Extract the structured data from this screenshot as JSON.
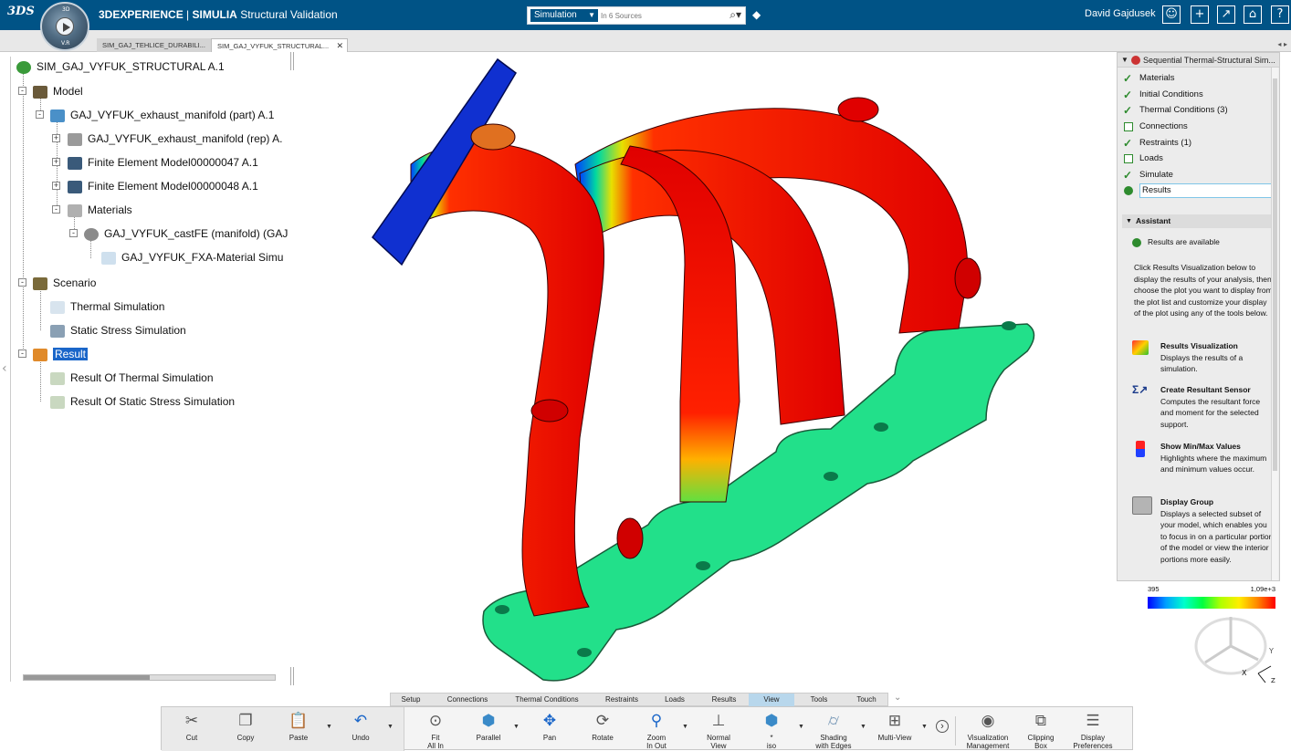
{
  "header": {
    "brand": "3DEXPERIENCE",
    "app_family": "SIMULIA",
    "app_name": "Structural Validation",
    "compass_north": "3D",
    "compass_south": "V.R",
    "search_scope": "Simulation",
    "search_placeholder": "In 6 Sources",
    "user_name": "David Gajdusek"
  },
  "tabs": [
    {
      "label": "SIM_GAJ_TEHLICE_DURABILI..."
    },
    {
      "label": "SIM_GAJ_VYFUK_STRUCTURAL..."
    }
  ],
  "tree": {
    "root": "SIM_GAJ_VYFUK_STRUCTURAL A.1",
    "model": "Model",
    "part": "GAJ_VYFUK_exhaust_manifold (part) A.1",
    "rep": "GAJ_VYFUK_exhaust_manifold (rep) A.",
    "fem47": "Finite Element Model00000047 A.1",
    "fem48": "Finite Element Model00000048 A.1",
    "materials": "Materials",
    "castfe": "GAJ_VYFUK_castFE (manifold) (GAJ",
    "fxa": "GAJ_VYFUK_FXA-Material Simu",
    "scenario": "Scenario",
    "thermal": "Thermal Simulation",
    "static": "Static Stress Simulation",
    "result": "Result",
    "res_thermal": "Result Of Thermal Simulation",
    "res_static": "Result Of Static Stress Simulation"
  },
  "panel": {
    "title": "Sequential Thermal-Structural Sim...",
    "steps": [
      {
        "label": "Materials",
        "state": "done"
      },
      {
        "label": "Initial Conditions",
        "state": "done"
      },
      {
        "label": "Thermal Conditions (3)",
        "state": "done"
      },
      {
        "label": "Connections",
        "state": "empty"
      },
      {
        "label": "Restraints (1)",
        "state": "done"
      },
      {
        "label": "Loads",
        "state": "empty"
      },
      {
        "label": "Simulate",
        "state": "done"
      },
      {
        "label": "Results",
        "state": "current"
      }
    ],
    "assistant_title": "Assistant",
    "status": "Results are available",
    "instructions": "Click Results Visualization below to display the results of your analysis, then choose the plot you want to display from the plot list and customize your display of the plot using any of the tools below.",
    "tools": [
      {
        "title": "Results Visualization",
        "desc": "Displays the results of a simulation."
      },
      {
        "title": "Create Resultant Sensor",
        "desc": "Computes the resultant force and moment for the selected support."
      },
      {
        "title": "Show Min/Max Values",
        "desc": "Highlights where the maximum and minimum values occur."
      },
      {
        "title": "Display Group",
        "desc": "Displays a selected subset of your model, which enables you to focus in on a particular portion of the model or view the interior portions more easily."
      }
    ]
  },
  "legend": {
    "min": "395",
    "max": "1,09e+3"
  },
  "triad": {
    "x": "X",
    "y": "Y",
    "z": "Z"
  },
  "toolbar_tabs": [
    "Setup",
    "Connections",
    "Thermal Conditions",
    "Restraints",
    "Loads",
    "Results",
    "View",
    "Tools",
    "Touch"
  ],
  "active_toolbar_tab": "View",
  "toolbar": {
    "cut": "Cut",
    "copy": "Copy",
    "paste": "Paste",
    "undo": "Undo",
    "fit_l1": "Fit",
    "fit_l2": "All In",
    "parallel": "Parallel",
    "pan": "Pan",
    "rotate": "Rotate",
    "zoom_l1": "Zoom",
    "zoom_l2": "In Out",
    "normal_l1": "Normal",
    "normal_l2": "View",
    "iso_l1": "*",
    "iso_l2": "iso",
    "shading_l1": "Shading",
    "shading_l2": "with Edges",
    "multiview": "Multi-View",
    "vis_l1": "Visualization",
    "vis_l2": "Management",
    "clip_l1": "Clipping",
    "clip_l2": "Box",
    "disp_l1": "Display",
    "disp_l2": "Preferences"
  },
  "colors": {
    "header": "#005386",
    "accent_tab": "#b8d7ec",
    "check": "#2e8b2e"
  }
}
